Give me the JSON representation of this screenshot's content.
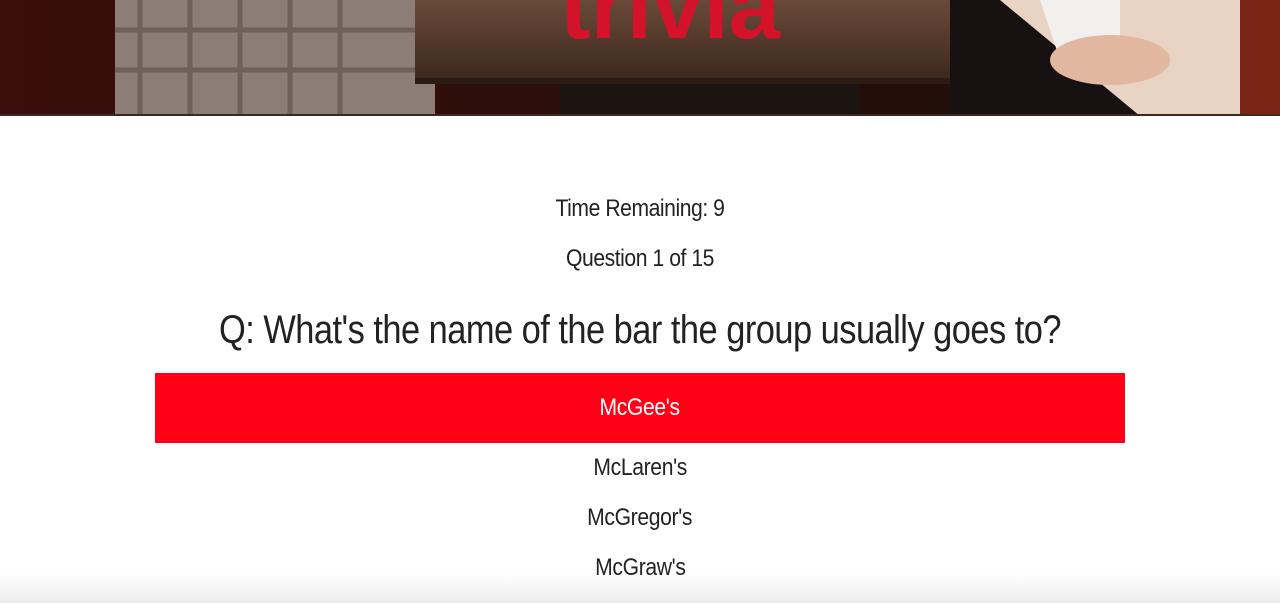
{
  "header": {
    "banner_text": "trivia"
  },
  "timer": {
    "label": "Time Remaining: 9"
  },
  "progress": {
    "label": "Question 1 of 15"
  },
  "question": {
    "text": "Q: What's the name of the bar the group usually goes to?"
  },
  "answers": [
    {
      "label": "McGee's",
      "selected": true
    },
    {
      "label": "McLaren's",
      "selected": false
    },
    {
      "label": "McGregor's",
      "selected": false
    },
    {
      "label": "McGraw's",
      "selected": false
    }
  ],
  "colors": {
    "selected_answer_bg": "#ff0017",
    "text": "#222222",
    "background": "#ffffff"
  }
}
